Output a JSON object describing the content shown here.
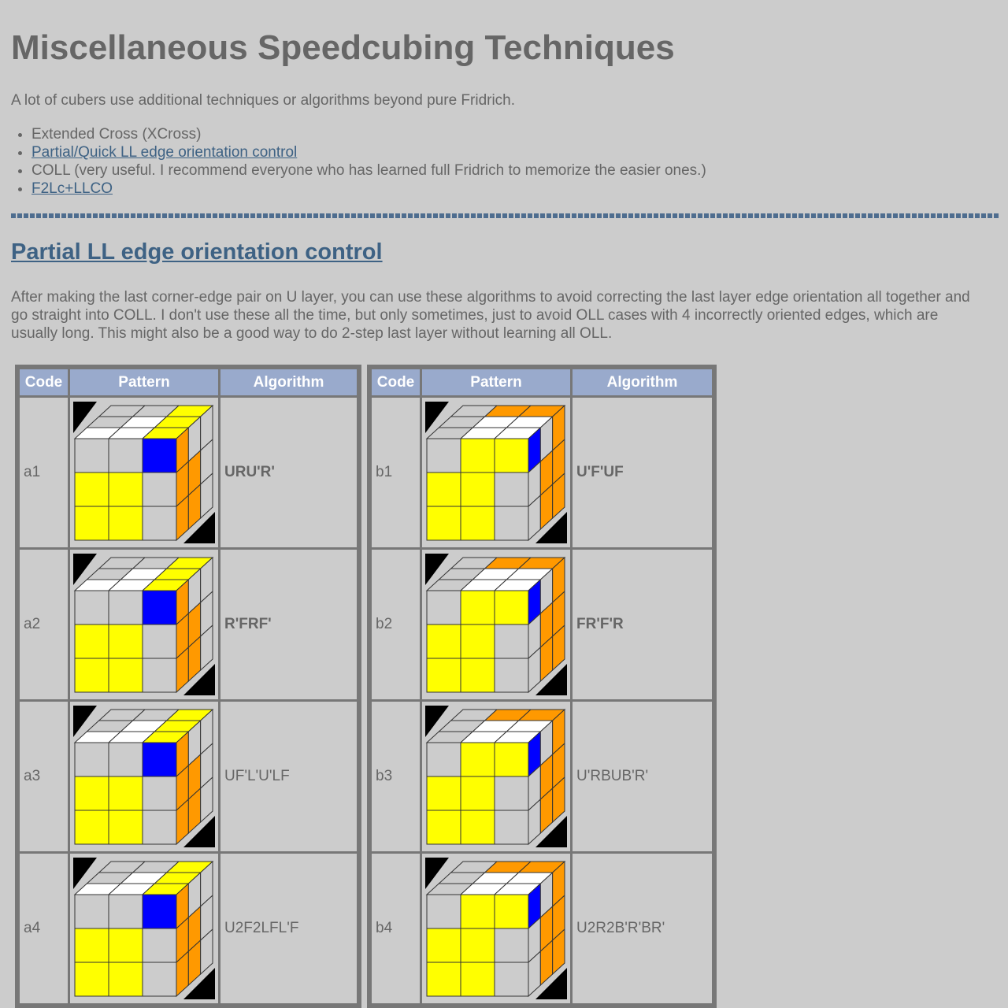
{
  "page": {
    "title": "Miscellaneous Speedcubing Techniques",
    "intro": "A lot of cubers use additional techniques or algorithms beyond pure Fridrich.",
    "techniques": [
      {
        "label": "Extended Cross (XCross)",
        "link": false
      },
      {
        "label": "Partial/Quick LL edge orientation control",
        "link": true
      },
      {
        "label": "COLL (very useful. I recommend everyone who has learned full Fridrich to memorize the easier ones.)",
        "link": false
      },
      {
        "label": "F2Lc+LLCO",
        "link": true
      }
    ],
    "section_title": "Partial LL edge orientation control",
    "section_desc": "After making the last corner-edge pair on U layer, you can use these algorithms to avoid correcting the last layer edge orientation all together and go straight into COLL. I don't use these all the time, but only sometimes, just to avoid OLL cases with 4 incorrectly oriented edges, which are usually long. This might also be a good way to do 2-step last layer without learning all OLL."
  },
  "table_headers": {
    "code": "Code",
    "pattern": "Pattern",
    "algorithm": "Algorithm"
  },
  "colors": {
    "yellow": "#ffff00",
    "orange": "#ff9900",
    "blue": "#0000ff",
    "white": "#ffffff",
    "grey": "#cccccc",
    "black": "#000000"
  },
  "table_a": [
    {
      "code": "a1",
      "alg": "URU'R'",
      "bold": true
    },
    {
      "code": "a2",
      "alg": "R'FRF'",
      "bold": true
    },
    {
      "code": "a3",
      "alg": "UF'L'U'LF",
      "bold": false
    },
    {
      "code": "a4",
      "alg": "U2F2LFL'F",
      "bold": false
    }
  ],
  "table_b": [
    {
      "code": "b1",
      "alg": "U'F'UF",
      "bold": true
    },
    {
      "code": "b2",
      "alg": "FR'F'R",
      "bold": true
    },
    {
      "code": "b3",
      "alg": "U'RBUB'R'",
      "bold": false
    },
    {
      "code": "b4",
      "alg": "U2R2B'R'BR'",
      "bold": false
    }
  ]
}
